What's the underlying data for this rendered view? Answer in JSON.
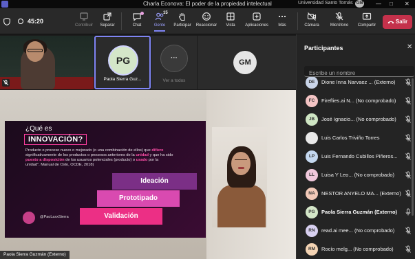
{
  "window": {
    "title": "Charla Econova: El poder de la propiedad intelectual",
    "org": "Universidad Santo Tomás",
    "user_initials": "GM",
    "controls": [
      "—",
      "□",
      "✕"
    ]
  },
  "toolbar": {
    "timer": "45:20",
    "buttons": [
      {
        "id": "contribuir",
        "label": "Contribuir",
        "icon": "contribute-icon",
        "enabled": false
      },
      {
        "id": "separar",
        "label": "Separar",
        "icon": "pop-out-icon",
        "enabled": true
      },
      {
        "id": "chat",
        "label": "Chat",
        "icon": "chat-icon",
        "enabled": true
      },
      {
        "id": "gente",
        "label": "Gente",
        "icon": "people-icon",
        "badge": "15",
        "active": true
      },
      {
        "id": "participar",
        "label": "Participar",
        "icon": "raise-hand-icon",
        "enabled": true
      },
      {
        "id": "reaccionar",
        "label": "Reaccionar",
        "icon": "react-icon",
        "enabled": true
      },
      {
        "id": "vista",
        "label": "Vista",
        "icon": "view-icon",
        "enabled": true
      },
      {
        "id": "aplicaciones",
        "label": "Aplicaciones",
        "icon": "apps-icon",
        "enabled": true
      },
      {
        "id": "mas",
        "label": "Más",
        "icon": "more-icon",
        "enabled": true
      },
      {
        "id": "camara",
        "label": "Cámara",
        "icon": "camera-off-icon",
        "enabled": true
      },
      {
        "id": "microfono",
        "label": "Micrófono",
        "icon": "mic-off-icon",
        "enabled": true
      },
      {
        "id": "compartir",
        "label": "Compartir",
        "icon": "share-icon",
        "enabled": true
      }
    ],
    "leave_label": "Salir",
    "accent": "#7f85f5",
    "leave_color": "#c4314b"
  },
  "gallery": {
    "tiles": [
      {
        "initials": "PG",
        "name": "Paola Sierra Guz..."
      },
      {
        "initials": "···",
        "name": "Ver a todos"
      },
      {
        "initials": "GM",
        "name": ""
      }
    ]
  },
  "slide": {
    "question": "¿Qué es",
    "title": "INNOVACIÓN?",
    "definition_1": "Producto o proceso nuevo o mejorado (o una combinación de ellos) que",
    "definition_2": "difiere",
    "definition_3": " significativamente de los productos o procesos anteriores de la",
    "definition_4": "unidad",
    "definition_5": " y que ha sido ",
    "definition_6": "puesto a disposición",
    "definition_7": " de los usuarios potenciales (producto) o ",
    "definition_8": "usado",
    "definition_9": " por la unidad\". Manual de Oslo, OCDE, 2018)",
    "stages": [
      "Ideación",
      "Prototipado",
      "Validación"
    ],
    "handle": "@PaoLaxxSierra"
  },
  "speaker_name": "Paola Sierra Guzmán (Externo)",
  "panel": {
    "title": "Participantes",
    "search_placeholder": "Escribe un nombre",
    "participants": [
      {
        "initials": "DE",
        "name": "Dione Inna Narvaez ... (Externo)",
        "color": "#c9d4e8",
        "bold": false
      },
      {
        "initials": "FC",
        "name": "Fireflies.ai N... (No comprobado)",
        "color": "#f4c4c4",
        "bold": false
      },
      {
        "initials": "JB",
        "name": "José Ignacio... (No comprobado)",
        "color": "#cfe6c4",
        "bold": false
      },
      {
        "initials": "",
        "name": "Luis Carlos Triviño Torres",
        "color": "#e8e8e8",
        "bold": false
      },
      {
        "initials": "LP",
        "name": "Luis Fernando Cubillos Piñeros...",
        "color": "#c4d8f0",
        "bold": false
      },
      {
        "initials": "LL",
        "name": "Luisa Y Leo... (No comprobado)",
        "color": "#f0c8dc",
        "bold": false
      },
      {
        "initials": "NA",
        "name": "NESTOR ANYELO MA... (Externo)",
        "color": "#f2c9b8",
        "bold": false
      },
      {
        "initials": "PG",
        "name": "Paola Sierra Guzmán (Externo)",
        "color": "#d4e6c8",
        "bold": true
      },
      {
        "initials": "RN",
        "name": "read.ai mee... (No comprobado)",
        "color": "#d8d0f0",
        "bold": false
      },
      {
        "initials": "RM",
        "name": "Rocío melg... (No comprobado)",
        "color": "#f4d4b4",
        "bold": false
      }
    ]
  }
}
